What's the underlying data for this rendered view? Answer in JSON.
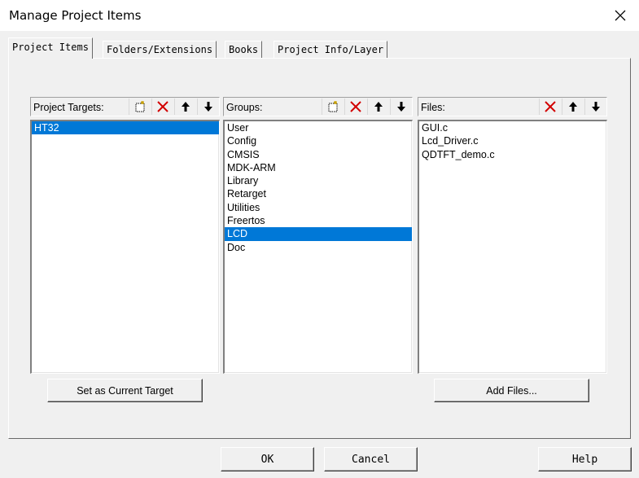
{
  "window": {
    "title": "Manage Project Items"
  },
  "tabs": [
    {
      "label": "Project Items",
      "active": true
    },
    {
      "label": "Folders/Extensions"
    },
    {
      "label": "Books"
    },
    {
      "label": "Project Info/Layer"
    }
  ],
  "targets": {
    "label": "Project Targets:",
    "items": [
      "HT32"
    ],
    "selected": "HT32",
    "button": "Set as Current Target"
  },
  "groups": {
    "label": "Groups:",
    "items": [
      "User",
      "Config",
      "CMSIS",
      "MDK-ARM",
      "Library",
      "Retarget",
      "Utilities",
      "Freertos",
      "LCD",
      "Doc"
    ],
    "selected": "LCD"
  },
  "files": {
    "label": "Files:",
    "items": [
      "GUI.c",
      "Lcd_Driver.c",
      "QDTFT_demo.c"
    ],
    "button": "Add Files..."
  },
  "footer": {
    "ok": "OK",
    "cancel": "Cancel",
    "help": "Help"
  },
  "icons": {
    "new": "new-item-icon",
    "delete": "delete-icon",
    "up": "move-up-icon",
    "down": "move-down-icon",
    "close": "close-icon"
  },
  "colors": {
    "selection": "#0078d7",
    "delete_red": "#d20000"
  }
}
